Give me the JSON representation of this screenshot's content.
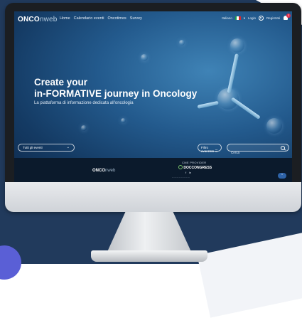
{
  "site": {
    "logo_main": "ONCO",
    "logo_suffix": "nweb"
  },
  "nav": {
    "items": [
      "Home",
      "Calendario eventi",
      "Oncotimes",
      "Survey"
    ],
    "language": "Italiano",
    "login": "Login",
    "register": "Registrati",
    "notification_count": "2"
  },
  "hero": {
    "title_line1": "Create your",
    "title_line2": "in-FORMATIVE journey in Oncology",
    "subtitle": "La piattaforma di informazione dedicata all'oncologia"
  },
  "filters": {
    "events_select": "Tutti gli eventi",
    "advanced_filter": "Filtro avanzato",
    "search_placeholder": "Cerca"
  },
  "footer": {
    "logo_main": "ONCO",
    "logo_suffix": "nweb",
    "provider_label": "CME PROVIDER",
    "provider_name": "DOCCONGRESS",
    "socials": [
      "f",
      "in"
    ]
  },
  "colors": {
    "nav_bg": "#213a5c",
    "accent": "#2e63a8",
    "badge": "#e32b48"
  }
}
